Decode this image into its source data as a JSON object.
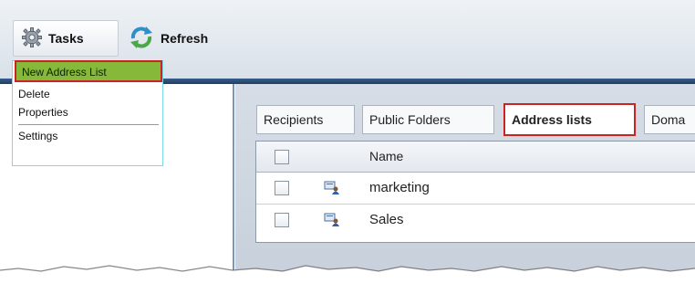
{
  "toolbar": {
    "tasks_label": "Tasks",
    "refresh_label": "Refresh"
  },
  "tasks_menu": {
    "items": [
      {
        "label": "New Address List"
      },
      {
        "label": "Delete"
      },
      {
        "label": "Properties"
      },
      {
        "label": "Settings"
      }
    ]
  },
  "tabs": [
    {
      "label": "Recipients"
    },
    {
      "label": "Public Folders"
    },
    {
      "label": "Address lists",
      "selected": true
    },
    {
      "label": "Doma"
    }
  ],
  "table": {
    "columns": [
      "Name"
    ],
    "rows": [
      {
        "name": "marketing",
        "icon": "address-list-icon"
      },
      {
        "name": "Sales",
        "icon": "address-list-icon"
      }
    ]
  },
  "colors": {
    "highlight_border": "#cc2222",
    "menu_selected": "#86b83a",
    "panel_bg": "#ced6e0"
  }
}
